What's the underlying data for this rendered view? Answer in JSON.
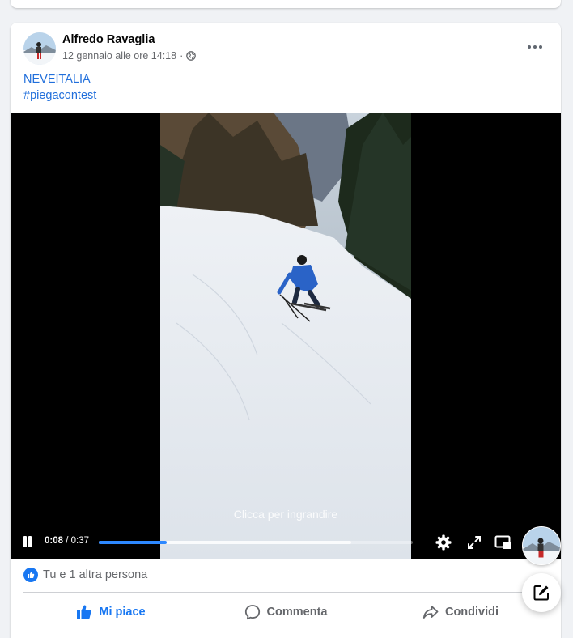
{
  "post": {
    "author": "Alfredo Ravaglia",
    "timestamp": "12 gennaio alle ore 14:18",
    "separator": "·",
    "privacy_icon": "globe-icon",
    "text_lines": [
      "NEVEITALIA",
      "#piegacontest"
    ]
  },
  "video": {
    "hint": "Clicca per ingrandire",
    "current_time": "0:08",
    "duration": "0:37",
    "time_separator": " / ",
    "progress_played": 0.216,
    "progress_buffered": 0.805
  },
  "reactions": {
    "summary": "Tu e 1 altra persona"
  },
  "actions": {
    "like": "Mi piace",
    "comment": "Commenta",
    "share": "Condividi"
  },
  "colors": {
    "accent": "#1877f2",
    "link": "#216fdb",
    "progress": "#2d88ff",
    "muted": "#65676b"
  }
}
